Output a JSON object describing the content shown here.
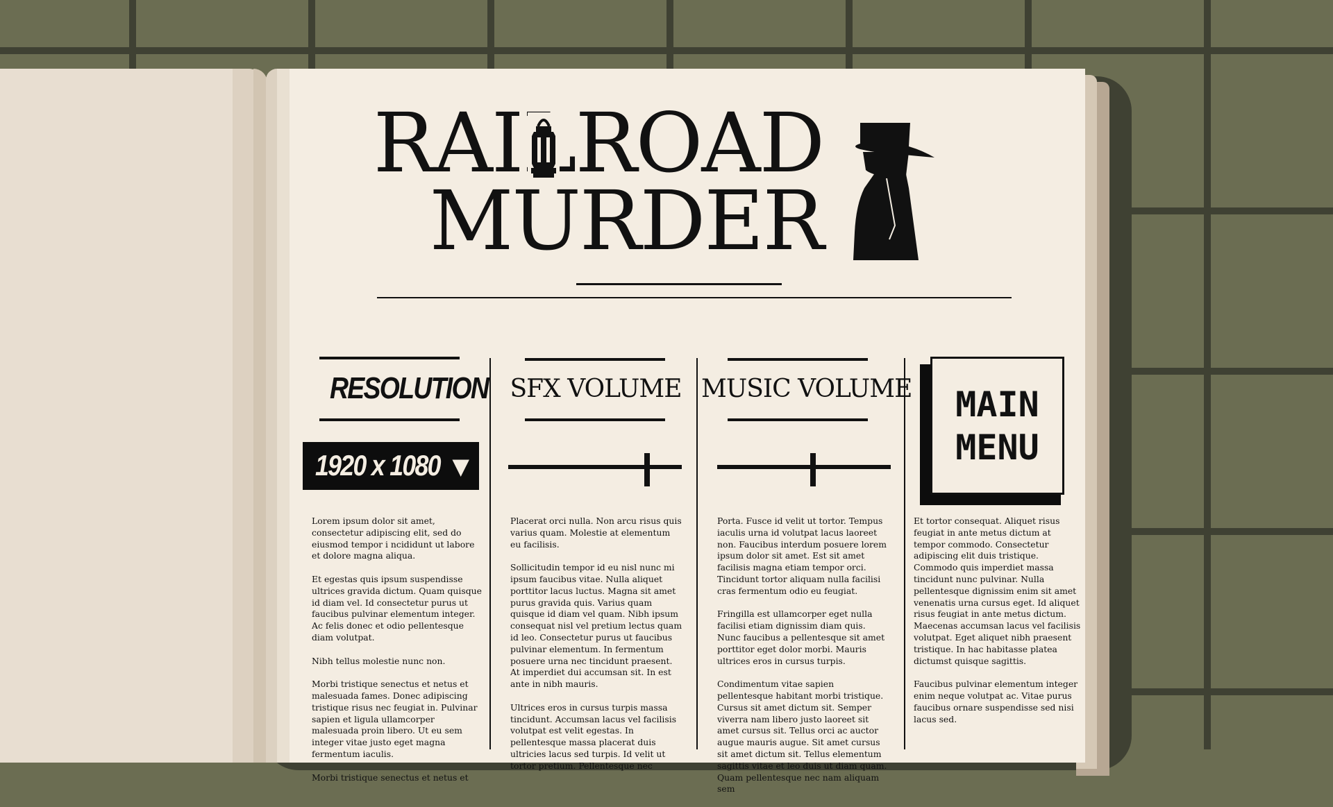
{
  "game": {
    "title_line1": "RAILROAD",
    "title_line2": "MURDER"
  },
  "settings": {
    "resolution": {
      "label": "RESOLUTION",
      "value": "1920 x 1080",
      "arrow": "▼"
    },
    "sfx_volume": {
      "label": "SFX VOLUME",
      "level": 0.8
    },
    "music_volume": {
      "label": "MUSIC VOLUME",
      "level": 0.55
    },
    "main_menu_label": "MAIN\nMENU"
  },
  "columns": [
    {
      "paragraphs": [
        "Lorem ipsum dolor sit amet, consectetur adipiscing elit, sed do eiusmod tempor i ncididunt ut labore et dolore magna aliqua.",
        "Et egestas quis ipsum suspendisse ultrices gravida dictum. Quam quisque id diam vel. Id consectetur purus ut faucibus pulvinar elementum integer. Ac felis donec et odio pellentesque diam volutpat.",
        "Nibh tellus molestie nunc non.",
        "Morbi tristique senectus et netus et malesuada fames. Donec adipiscing tristique risus nec feugiat in. Pulvinar sapien et ligula ullamcorper malesuada proin libero. Ut eu sem integer vitae justo eget magna fermentum iaculis.",
        "Morbi tristique senectus et netus et"
      ]
    },
    {
      "paragraphs": [
        "Placerat orci nulla. Non arcu risus quis varius quam. Molestie at elementum eu facilisis.",
        "Sollicitudin tempor id eu nisl nunc mi ipsum faucibus vitae. Nulla aliquet porttitor lacus luctus. Magna sit amet purus gravida quis. Varius quam quisque id diam vel quam. Nibh ipsum consequat nisl vel pretium lectus quam id leo. Consectetur purus ut faucibus pulvinar elementum. In fermentum posuere urna nec tincidunt praesent. At imperdiet dui accumsan sit. In est ante in nibh mauris.",
        "Ultrices eros in cursus turpis massa tincidunt. Accumsan lacus vel facilisis volutpat est velit egestas. In pellentesque massa placerat duis ultricies lacus sed turpis. Id velit ut tortor pretium. Pellentesque nec"
      ]
    },
    {
      "paragraphs": [
        "Porta. Fusce id velit ut tortor. Tempus iaculis urna id volutpat lacus laoreet non. Faucibus interdum posuere lorem ipsum dolor sit amet. Est sit amet facilisis magna etiam tempor orci. Tincidunt tortor aliquam nulla facilisi cras fermentum odio eu feugiat.",
        "Fringilla est ullamcorper eget nulla facilisi etiam dignissim diam quis. Nunc faucibus a pellentesque sit amet porttitor eget dolor morbi. Mauris ultrices eros in cursus turpis.",
        "Condimentum vitae sapien pellentesque habitant morbi tristique. Cursus sit amet dictum sit. Semper viverra nam libero justo laoreet sit amet cursus sit. Tellus orci ac auctor augue mauris augue. Sit amet cursus sit amet dictum sit. Tellus elementum sagittis vitae et leo duis ut diam quam. Quam pellentesque nec nam aliquam sem"
      ]
    },
    {
      "paragraphs": [
        "Et tortor consequat. Aliquet risus feugiat in ante metus dictum at tempor commodo. Consectetur adipiscing elit duis tristique. Commodo quis imperdiet massa tincidunt nunc pulvinar. Nulla pellentesque dignissim enim sit amet venenatis urna cursus eget. Id aliquet risus feugiat in ante metus dictum. Maecenas accumsan lacus vel facilisis volutpat. Eget aliquet nibh praesent tristique. In hac habitasse platea dictumst quisque sagittis.",
        "Faucibus pulvinar elementum integer enim neque volutpat ac. Vitae purus faucibus ornare suspendisse sed nisi lacus sed."
      ]
    }
  ]
}
